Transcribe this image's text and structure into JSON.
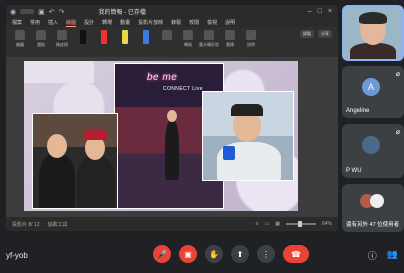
{
  "meeting": {
    "code": "yf-yob"
  },
  "ppt": {
    "doc_title": "我的簡報 - 已存檔",
    "saved": "已存檔",
    "tabs": [
      "檔案",
      "常用",
      "插入",
      "繪圖",
      "設計",
      "轉場",
      "動畫",
      "投影片放映",
      "錄製",
      "校閱",
      "檢視",
      "說明"
    ],
    "active_tab": "繪圖",
    "tools": [
      "繪圖",
      "選取",
      "橡皮擦",
      "筆",
      "螢光筆",
      "筆",
      "筆",
      "轉換",
      "墨水轉形狀",
      "重播",
      "說明"
    ],
    "right_chips": [
      "錄製",
      "分享"
    ],
    "status_left": "投影片 8/ 12",
    "status_mid": "協助工具",
    "zoom": "64%"
  },
  "slide": {
    "neon_text": "be me",
    "connect_text": "CONNECT Live"
  },
  "participants": [
    {
      "id": "self",
      "name": ""
    },
    {
      "id": "angeline",
      "name": "Angeline",
      "initial": "A"
    },
    {
      "id": "pwu",
      "name": "P WU"
    },
    {
      "id": "more",
      "name": "還有另外 47 位使用者"
    }
  ],
  "controls": {
    "mic": "mic-off-icon",
    "camera": "camera-off-icon",
    "hand": "hand-icon",
    "present": "present-icon",
    "more": "more-icon",
    "end": "end-call-icon"
  },
  "colors": {
    "end_call": "#ea4335",
    "active_border": "#8ab4f8"
  }
}
